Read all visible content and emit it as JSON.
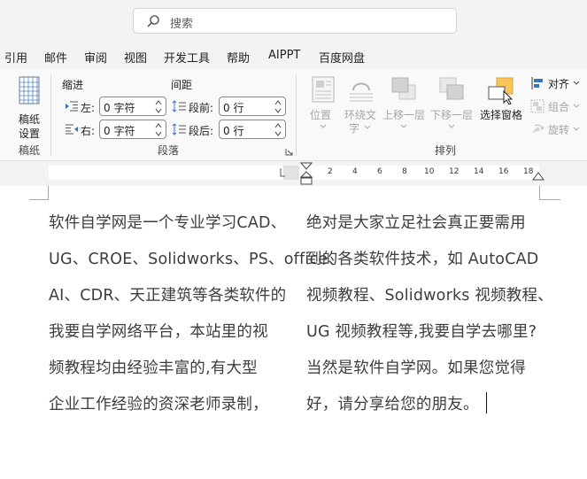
{
  "search": {
    "placeholder": "搜索"
  },
  "menu_tabs": [
    "引用",
    "邮件",
    "审阅",
    "视图",
    "开发工具",
    "帮助",
    "AIPPT",
    "百度网盘"
  ],
  "ribbon": {
    "manuscript": {
      "button_line1": "稿纸",
      "button_line2": "设置",
      "group_label": "稿纸"
    },
    "paragraph": {
      "indent_title": "缩进",
      "spacing_title": "间距",
      "left_label": "左:",
      "right_label": "右:",
      "before_label": "段前:",
      "after_label": "段后:",
      "left_value": "0 字符",
      "right_value": "0 字符",
      "before_value": "0 行",
      "after_value": "0 行",
      "group_label": "段落"
    },
    "arrange": {
      "position": "位置",
      "wrap_line1": "环绕文",
      "wrap_line2": "字",
      "bring_forward": "上移一层",
      "send_backward": "下移一层",
      "selection_pane": "选择窗格",
      "align": "对齐",
      "group": "组合",
      "rotate": "旋转",
      "group_label": "排列"
    }
  },
  "ruler": {
    "ticks": [
      "2",
      "4",
      "6",
      "8",
      "10",
      "12",
      "14",
      "16",
      "18"
    ]
  },
  "document": {
    "left_column": [
      "软件自学网是一个专业学习CAD、",
      "UG、CROE、Solidworks、PS、office、",
      "AI、CDR、天正建筑等各类软件的",
      "我要自学网络平台，本站里的视",
      "频教程均由经验丰富的,有大型",
      "企业工作经验的资深老师录制，"
    ],
    "right_column": [
      "绝对是大家立足社会真正要需用",
      "到的各类软件技术，如 AutoCAD",
      "视频教程、Solidworks 视频教程、",
      "UG 视频教程等,我要自学去哪里?",
      "当然是软件自学网。如果您觉得",
      "好，请分享给您的朋友。"
    ]
  },
  "colors": {
    "chrome": "#f3f3f3",
    "ribbon": "#f9f9f9",
    "accent_yellow": "#f7c65a",
    "text": "#3d3d3d"
  }
}
